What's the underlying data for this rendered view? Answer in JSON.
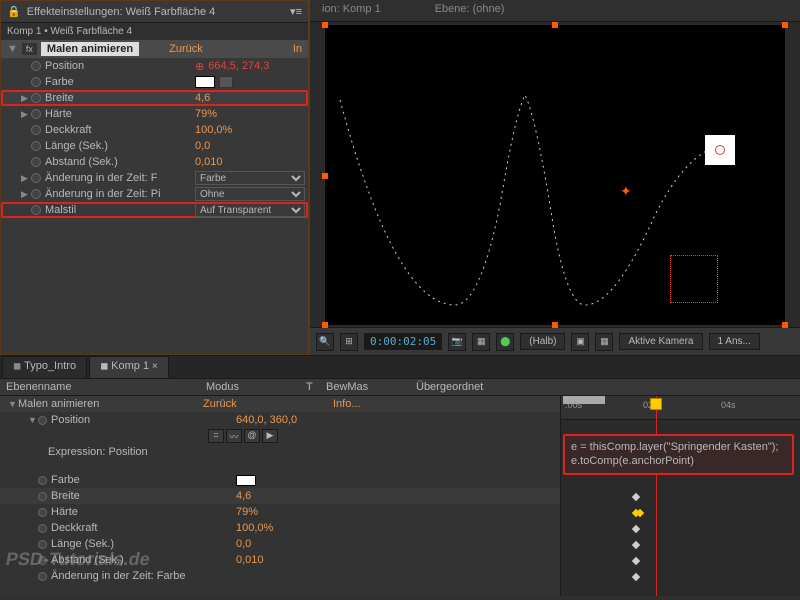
{
  "header": {
    "title": "Effekteinstellungen: Weiß Farbfläche 4",
    "tab_comp": "ion: Komp 1",
    "tab_layer": "Ebene: (ohne)"
  },
  "breadcrumb": "Komp 1 • Weiß Farbfläche 4",
  "effect": {
    "fx": "fx",
    "name": "Malen animieren",
    "reset": "Zurück",
    "info": "In"
  },
  "props": {
    "position": {
      "label": "Position",
      "val": "664,5, 274,3"
    },
    "farbe": {
      "label": "Farbe"
    },
    "breite": {
      "label": "Breite",
      "val": "4,6"
    },
    "haerte": {
      "label": "Härte",
      "val": "79%"
    },
    "deckkraft": {
      "label": "Deckkraft",
      "val": "100,0%"
    },
    "laenge": {
      "label": "Länge (Sek.)",
      "val": "0,0"
    },
    "abstand": {
      "label": "Abstand (Sek.)",
      "val": "0,010"
    },
    "aenderF": {
      "label": "Änderung in der Zeit: F",
      "val": "Farbe"
    },
    "aenderP": {
      "label": "Änderung in der Zeit: Pi",
      "val": "Ohne"
    },
    "malstil": {
      "label": "Malstil",
      "val": "Auf Transparent"
    }
  },
  "viewer": {
    "timecode": "0:00:02:05",
    "res": "(Halb)",
    "camera": "Aktive Kamera",
    "views": "1 Ans..."
  },
  "timeline": {
    "tabs": {
      "typo": "Typo_Intro",
      "komp": "Komp 1"
    },
    "cols": {
      "name": "Ebenenname",
      "mode": "Modus",
      "t": "T",
      "bewmas": "BewMas",
      "parent": "Übergeordnet"
    },
    "rows": {
      "effect": {
        "label": "Malen animieren",
        "reset": "Zurück",
        "info": "Info..."
      },
      "position": {
        "label": "Position",
        "val": "640,0, 360,0"
      },
      "expr": {
        "label": "Expression: Position"
      },
      "farbe": {
        "label": "Farbe"
      },
      "breite": {
        "label": "Breite",
        "val": "4,6"
      },
      "haerte": {
        "label": "Härte",
        "val": "79%"
      },
      "deckkraft": {
        "label": "Deckkraft",
        "val": "100,0%"
      },
      "laenge": {
        "label": "Länge (Sek.)",
        "val": "0,0"
      },
      "abstand": {
        "label": "Abstand (Sek.)",
        "val": "0,010"
      },
      "aender": {
        "label": "Änderung in der Zeit: Farbe"
      }
    },
    "ruler": {
      "t0": ":00s",
      "t2": "02s",
      "t4": "04s"
    },
    "expression": "e = thisComp.layer(\"Springender Kasten\");\ne.toComp(e.anchorPoint)"
  },
  "watermark": "PSD-Tutorials.de"
}
